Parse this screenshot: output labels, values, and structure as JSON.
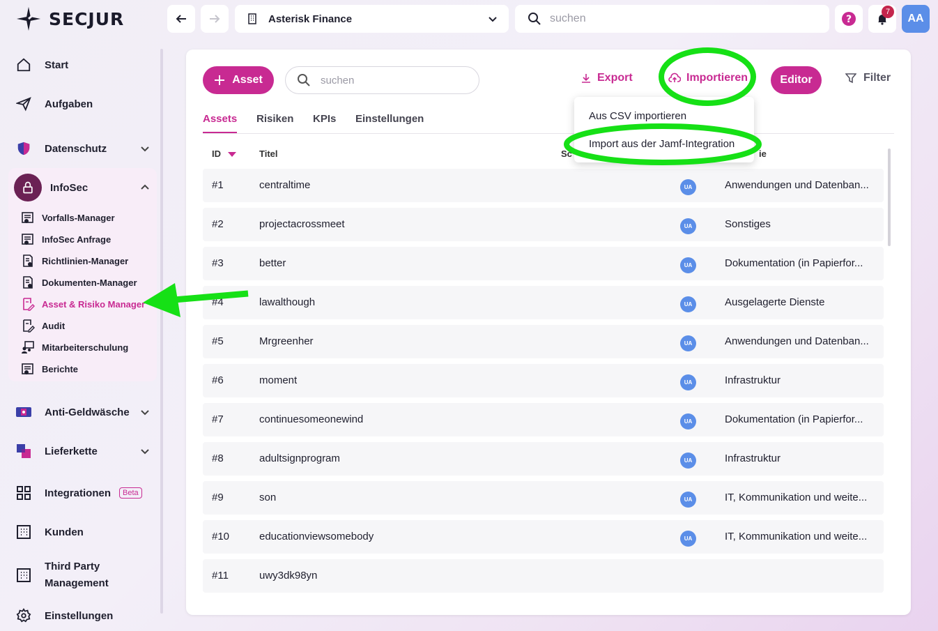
{
  "app": {
    "brand": "SECJUR",
    "accent": "#c82a92",
    "annotation_color": "#16e016"
  },
  "topbar": {
    "organization": "Asterisk Finance",
    "search_placeholder": "suchen",
    "notification_count": "7",
    "avatar_initials": "AA"
  },
  "sidebar": {
    "start": "Start",
    "tasks": "Aufgaben",
    "privacy": "Datenschutz",
    "infosec": "InfoSec",
    "infosec_items": [
      "Vorfalls-Manager",
      "InfoSec Anfrage",
      "Richtlinien-Manager",
      "Dokumenten-Manager",
      "Asset & Risiko Manager",
      "Audit",
      "Mitarbeiterschulung",
      "Berichte"
    ],
    "aml": "Anti-Geldwäsche",
    "supply_chain": "Lieferkette",
    "integrations": "Integrationen",
    "integrations_badge": "Beta",
    "customers": "Kunden",
    "tpm_line1": "Third Party",
    "tpm_line2": "Management",
    "settings": "Einstellungen"
  },
  "toolbar": {
    "add_asset": "Asset",
    "search_placeholder": "suchen",
    "export": "Export",
    "import": "Importieren",
    "editor": "Editor",
    "filter": "Filter"
  },
  "import_menu": [
    "Aus CSV importieren",
    "Import aus der Jamf-Integration"
  ],
  "tabs": [
    "Assets",
    "Risiken",
    "KPIs",
    "Einstellungen"
  ],
  "table": {
    "headers": {
      "id": "ID",
      "title": "Titel",
      "hidden_col": "Sc",
      "category": "ie"
    },
    "rows": [
      {
        "id": "#1",
        "title": "centraltime",
        "owner": "UA",
        "category": "Anwendungen und Datenban..."
      },
      {
        "id": "#2",
        "title": "projectacrossmeet",
        "owner": "UA",
        "category": "Sonstiges"
      },
      {
        "id": "#3",
        "title": "better",
        "owner": "UA",
        "category": "Dokumentation (in Papierfor..."
      },
      {
        "id": "#4",
        "title": "lawalthough",
        "owner": "UA",
        "category": "Ausgelagerte Dienste"
      },
      {
        "id": "#5",
        "title": "Mrgreenher",
        "owner": "UA",
        "category": "Anwendungen und Datenban..."
      },
      {
        "id": "#6",
        "title": "moment",
        "owner": "UA",
        "category": "Infrastruktur"
      },
      {
        "id": "#7",
        "title": "continuesomeonewind",
        "owner": "UA",
        "category": "Dokumentation (in Papierfor..."
      },
      {
        "id": "#8",
        "title": "adultsignprogram",
        "owner": "UA",
        "category": "Infrastruktur"
      },
      {
        "id": "#9",
        "title": "son",
        "owner": "UA",
        "category": "IT, Kommunikation und weite..."
      },
      {
        "id": "#10",
        "title": "educationviewsomebody",
        "owner": "UA",
        "category": "IT, Kommunikation und weite..."
      },
      {
        "id": "#11",
        "title": "uwy3dk98yn",
        "owner": "",
        "category": ""
      }
    ]
  }
}
